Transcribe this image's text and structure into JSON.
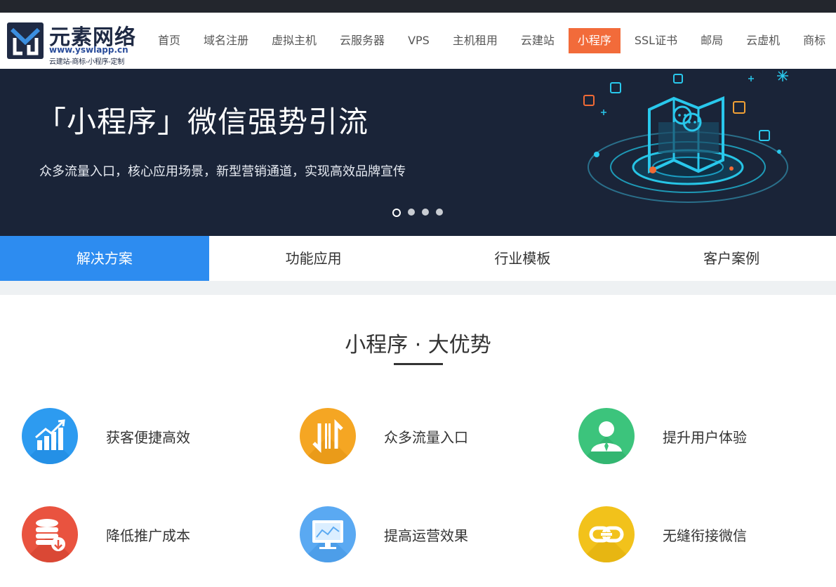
{
  "logo": {
    "title": "元素网络",
    "url": "www.yswlapp.cn",
    "tagline": "云建站-商标-小程序-定制"
  },
  "nav": {
    "items": [
      "首页",
      "域名注册",
      "虚拟主机",
      "云服务器",
      "VPS",
      "主机租用",
      "云建站",
      "小程序",
      "SSL证书",
      "邮局",
      "云虚机",
      "商标"
    ],
    "active": "小程序"
  },
  "banner": {
    "title": "「小程序」微信强势引流",
    "subtitle": "众多流量入口，核心应用场景，新型营销通道，实现高效品牌宣传",
    "slide_count": 4,
    "active_slide": 1
  },
  "tabs": {
    "items": [
      "解决方案",
      "功能应用",
      "行业模板",
      "客户案例"
    ],
    "active": "解决方案"
  },
  "section": {
    "title": "小程序 · 大优势"
  },
  "features": [
    {
      "label": "获客便捷高效",
      "icon": "growth-chart-icon",
      "color": "#2d9bf0"
    },
    {
      "label": "众多流量入口",
      "icon": "traffic-arrows-icon",
      "color": "#f5a623"
    },
    {
      "label": "提升用户体验",
      "icon": "user-icon",
      "color": "#3cc47c"
    },
    {
      "label": "降低推广成本",
      "icon": "database-down-icon",
      "color": "#e9533f"
    },
    {
      "label": "提高运营效果",
      "icon": "monitor-chart-icon",
      "color": "#5aa9f2"
    },
    {
      "label": "无缝衔接微信",
      "icon": "link-icon",
      "color": "#f2c21b"
    }
  ],
  "colors": {
    "nav_active": "#f26b3a",
    "tab_active": "#2d8cf0",
    "banner_bg": "#1a2438",
    "topbar": "#23262d"
  }
}
